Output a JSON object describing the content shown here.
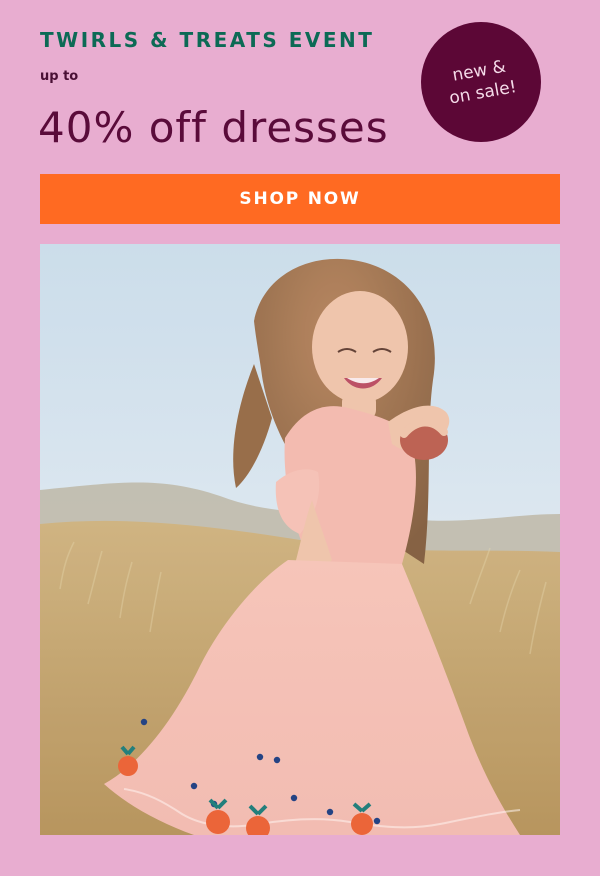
{
  "promo": {
    "event_title": "TWIRLS & TREATS EVENT",
    "pre_offer": "up to",
    "offer": "40% off dresses"
  },
  "badge": {
    "text": "new &\non sale!"
  },
  "cta": {
    "label": "SHOP NOW"
  },
  "colors": {
    "background": "#e8add0",
    "event_title": "#0c6a55",
    "offer": "#5a0b3a",
    "badge": "#5c0736",
    "cta": "#ff6a22"
  },
  "hero_image": {
    "icon": "girl-in-pink-dress-photo"
  }
}
